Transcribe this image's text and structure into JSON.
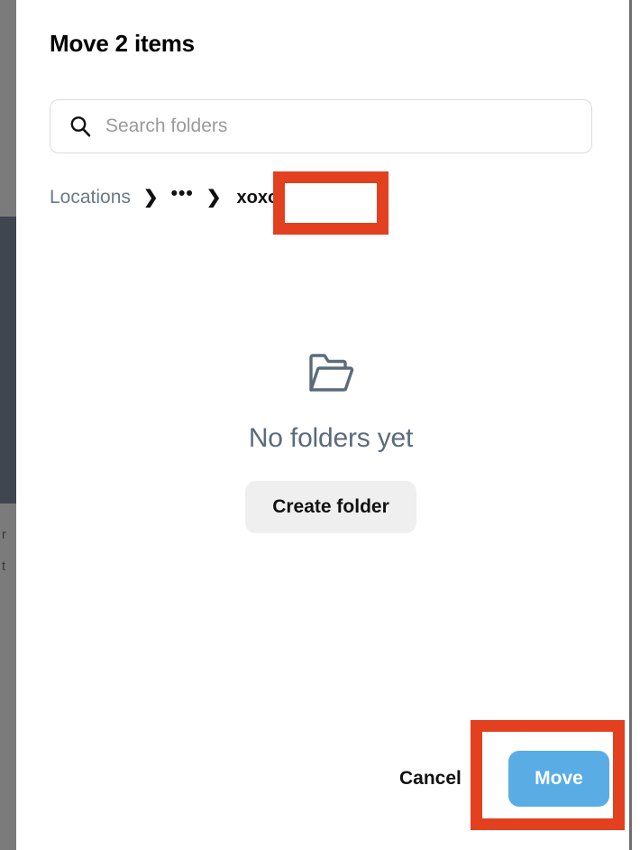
{
  "background": {
    "text_fragment_1": "r",
    "text_fragment_2": "t"
  },
  "dialog": {
    "title": "Move 2 items",
    "search": {
      "placeholder": "Search folders",
      "value": "",
      "icon": "search-icon"
    },
    "breadcrumb": {
      "root_label": "Locations",
      "separator": "❯",
      "ellipsis": "•••",
      "current_label": "xoxo"
    },
    "empty_state": {
      "icon": "open-folder-icon",
      "title": "No folders yet",
      "create_folder_label": "Create folder"
    },
    "footer": {
      "cancel_label": "Cancel",
      "move_label": "Move"
    }
  },
  "annotations": {
    "highlight_color": "#e2401f",
    "targets": [
      "breadcrumb-current-xoxo",
      "move-button"
    ]
  },
  "colors": {
    "primary_button": "#5aade4",
    "secondary_button": "#efefef",
    "muted_text": "#68798c",
    "empty_title": "#5b6b7b",
    "overlay": "#7b7b7b",
    "backdrop_nav": "#3f4650"
  }
}
